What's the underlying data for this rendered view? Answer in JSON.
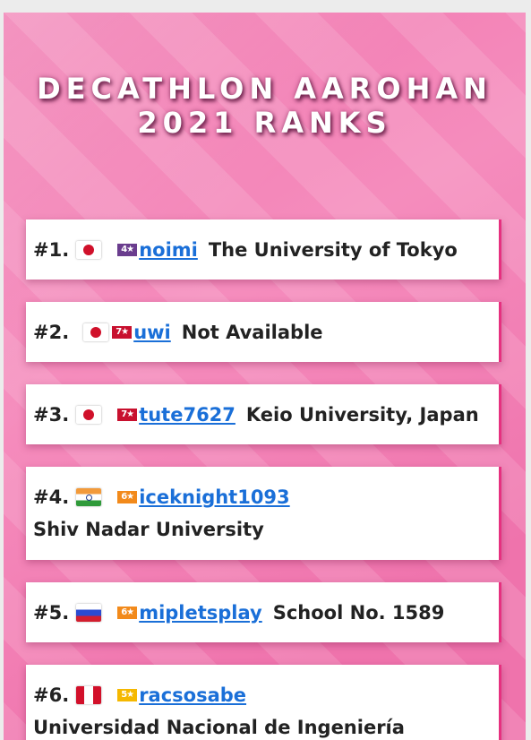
{
  "title_line1": "DECATHLON AAROHAN",
  "title_line2": "2021 RANKS",
  "ranks": [
    {
      "rank": "#1.",
      "flag": "japan-flag",
      "star": "4★",
      "star_color": "#6a3d8e",
      "handle": "noimi",
      "school": "The University of Tokyo"
    },
    {
      "rank": "#2.",
      "flag": "japan-flag",
      "star": "7★",
      "star_color": "#c8102e",
      "handle": "uwi",
      "school": "Not Available"
    },
    {
      "rank": "#3.",
      "flag": "japan-flag",
      "star": "7★",
      "star_color": "#c8102e",
      "handle": "tute7627",
      "school": "Keio University, Japan"
    },
    {
      "rank": "#4.",
      "flag": "india-flag",
      "star": "6★",
      "star_color": "#f28a1b",
      "handle": "iceknight1093",
      "school": "Shiv Nadar University"
    },
    {
      "rank": "#5.",
      "flag": "russia-flag",
      "star": "6★",
      "star_color": "#f28a1b",
      "handle": "mipletsplay",
      "school": "School No. 1589"
    },
    {
      "rank": "#6.",
      "flag": "peru-flag",
      "star": "5★",
      "star_color": "#f5b800",
      "handle": "racsosabe",
      "school": "Universidad Nacional de Ingeniería"
    }
  ]
}
